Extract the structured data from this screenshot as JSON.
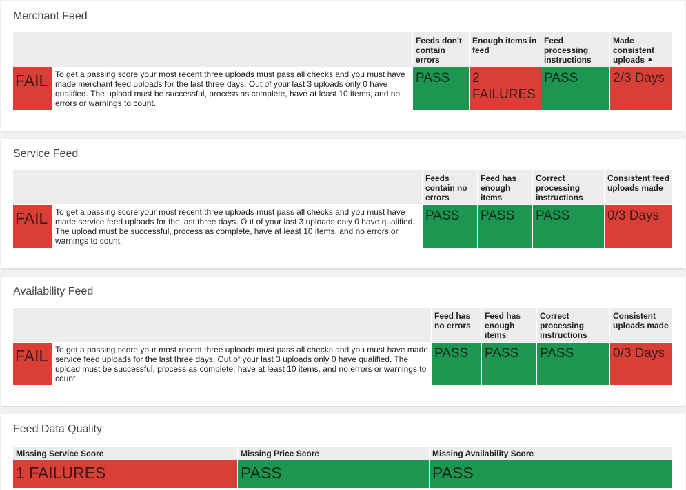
{
  "merchant": {
    "title": "Merchant Feed",
    "status": "FAIL",
    "description": "To get a passing score your most recent three uploads must pass all checks and you must have made merchant feed uploads for the last three days. Out of your last 3 uploads only 0 have qualified. The upload must be successful, process as complete, have at least 10 items, and no errors or warnings to count.",
    "columns": [
      {
        "header": "Feeds don't contain errors",
        "value": "PASS",
        "status": "pass"
      },
      {
        "header": "Enough items in feed",
        "value": "2 FAILURES",
        "status": "fail"
      },
      {
        "header": "Feed processing instructions",
        "value": "PASS",
        "status": "pass"
      },
      {
        "header": "Made consistent uploads",
        "value": "2/3 Days",
        "status": "fail"
      }
    ]
  },
  "service": {
    "title": "Service Feed",
    "status": "FAIL",
    "description": "To get a passing score your most recent three uploads must pass all checks and you must have made service feed uploads for the last three days. Out of your last 3 uploads only 0  have qualified. The upload must be successful, process as complete, have at least 10 items, and no errors or warnings to count.",
    "columns": [
      {
        "header": "Feeds contain no errors",
        "value": "PASS",
        "status": "pass"
      },
      {
        "header": "Feed has enough items",
        "value": "PASS",
        "status": "pass"
      },
      {
        "header": "Correct processing instructions",
        "value": "PASS",
        "status": "pass"
      },
      {
        "header": "Consistent feed uploads made",
        "value": "0/3 Days",
        "status": "fail"
      }
    ]
  },
  "availability": {
    "title": "Availability Feed",
    "status": "FAIL",
    "description": "To get a passing score your most recent three uploads must pass all checks and you must have made service feed uploads for the last three days. Out of your last 3 uploads only 0 have qualified. The upload must be successful, process as complete, have at least 10 items, and no errors or warnings to count.",
    "columns": [
      {
        "header": "Feed has no errors",
        "value": "PASS",
        "status": "pass"
      },
      {
        "header": "Feed has enough items",
        "value": "PASS",
        "status": "pass"
      },
      {
        "header": "Correct processing instructions",
        "value": "PASS",
        "status": "pass"
      },
      {
        "header": "Consistent uploads made",
        "value": "0/3 Days",
        "status": "fail"
      }
    ]
  },
  "quality": {
    "title": "Feed Data Quality",
    "columns": [
      {
        "header": "Missing Service Score",
        "value": "1 FAILURES",
        "status": "fail"
      },
      {
        "header": "Missing Price Score",
        "value": "PASS",
        "status": "pass"
      },
      {
        "header": "Missing Availability Score",
        "value": "PASS",
        "status": "pass"
      }
    ]
  },
  "colors": {
    "pass": "#1d9651",
    "fail": "#d93f36",
    "header_bg": "#ececec"
  },
  "icons": {
    "sort_indicator": "sort-ascending-icon"
  }
}
